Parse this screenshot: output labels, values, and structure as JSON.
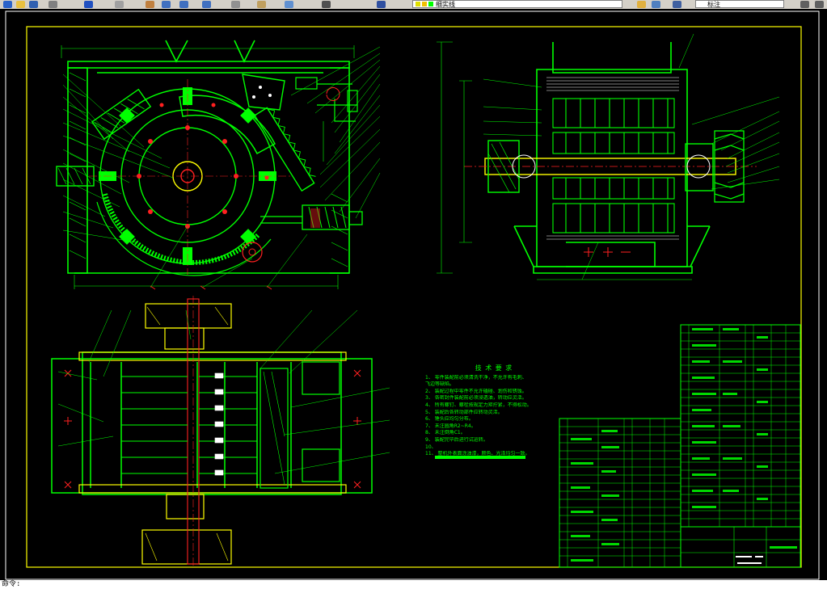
{
  "toolbar": {
    "layer_name": "细实线",
    "style_name": "标注",
    "colors": {
      "face": "#d4d0c8",
      "layer_swatch": "#00ff00"
    }
  },
  "tech": {
    "title": "技 术 要 求",
    "lines": [
      "1、 零件装配前必须清洗干净，不允许有毛刺、",
      "   飞边等缺陷。",
      "2、 装配过程中零件不允许磕碰、划伤和锈蚀。",
      "3、 各密封件装配前必须浸透油，转动应灵活。",
      "4、 所有螺钉、螺栓按规定力矩拧紧，不得松动。",
      "5、 装配后各转动部件应转动灵活。",
      "6、 锤头应均匀分布。",
      "7、 未注圆角R2~R4。",
      "8、 未注倒角C1。",
      "9、 装配完毕后进行试运转。",
      "10、",
      "11、 整机外表面涂油漆，颜色、光泽均匀一致。"
    ]
  },
  "command": {
    "text": "命令:"
  },
  "colors": {
    "background": "#000000",
    "outline_green": "#00ff00",
    "object_yellow": "#ffff00",
    "leader_cyan": "#00ffff",
    "hatch_red": "#ff2020",
    "frame_white": "#ffffff"
  },
  "icons": [
    "new-icon",
    "open-icon",
    "save-icon",
    "print-icon",
    "undo-icon",
    "redo-icon",
    "pan-icon",
    "zoom-realtime-icon",
    "zoom-window-icon",
    "zoom-previous-icon",
    "properties-icon",
    "design-center-icon",
    "tool-palette-icon",
    "calculator-icon",
    "layer-manager-icon",
    "layer-state-icon",
    "dim-style-icon"
  ]
}
